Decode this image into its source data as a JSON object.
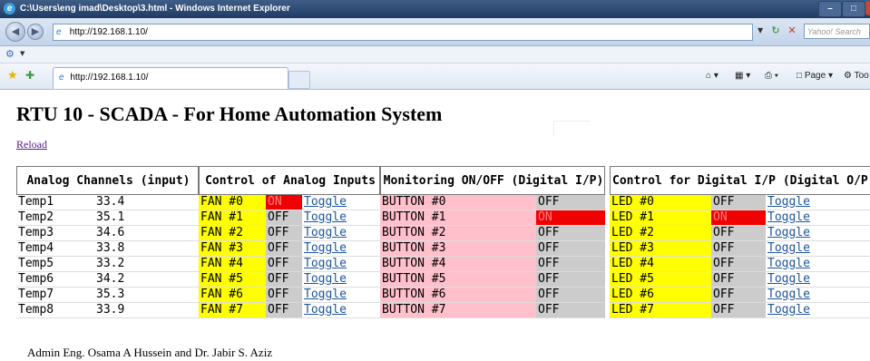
{
  "window": {
    "title": "C:\\Users\\eng imad\\Desktop\\3.html - Windows Internet Explorer",
    "address": "http://192.168.1.10/",
    "search_placeholder": "Yahoo! Search",
    "tab_title": "http://192.168.1.10/",
    "commands": {
      "page": "Page",
      "tools": "Too"
    }
  },
  "page": {
    "title": "RTU 10 - SCADA - For Home Automation System",
    "reload": "Reload",
    "footer": "Admin Eng. Osama A Hussein and Dr. Jabir S. Aziz"
  },
  "panels": {
    "analog": {
      "header": "Analog Channels (input)",
      "rows": [
        {
          "name": "Temp1",
          "value": "33.4"
        },
        {
          "name": "Temp2",
          "value": "35.1"
        },
        {
          "name": "Temp3",
          "value": "34.6"
        },
        {
          "name": "Temp4",
          "value": "33.8"
        },
        {
          "name": "Temp5",
          "value": "33.2"
        },
        {
          "name": "Temp6",
          "value": "34.2"
        },
        {
          "name": "Temp7",
          "value": "35.3"
        },
        {
          "name": "Temp8",
          "value": "33.9"
        }
      ]
    },
    "fans": {
      "header": "Control of Analog Inputs",
      "toggle": "Toggle",
      "rows": [
        {
          "label": "FAN #0",
          "state": "ON"
        },
        {
          "label": "FAN #1",
          "state": "OFF"
        },
        {
          "label": "FAN #2",
          "state": "OFF"
        },
        {
          "label": "FAN #3",
          "state": "OFF"
        },
        {
          "label": "FAN #4",
          "state": "OFF"
        },
        {
          "label": "FAN #5",
          "state": "OFF"
        },
        {
          "label": "FAN #6",
          "state": "OFF"
        },
        {
          "label": "FAN #7",
          "state": "OFF"
        }
      ]
    },
    "buttons": {
      "header": "Monitoring ON/OFF (Digital I/P)",
      "rows": [
        {
          "label": "BUTTON #0",
          "state": "OFF"
        },
        {
          "label": "BUTTON #1",
          "state": "ON"
        },
        {
          "label": "BUTTON #2",
          "state": "OFF"
        },
        {
          "label": "BUTTON #3",
          "state": "OFF"
        },
        {
          "label": "BUTTON #4",
          "state": "OFF"
        },
        {
          "label": "BUTTON #5",
          "state": "OFF"
        },
        {
          "label": "BUTTON #6",
          "state": "OFF"
        },
        {
          "label": "BUTTON #7",
          "state": "OFF"
        }
      ]
    },
    "leds": {
      "header": "Control for Digital I/P (Digital O/P)",
      "toggle": "Toggle",
      "rows": [
        {
          "label": "LED #0",
          "state": "OFF"
        },
        {
          "label": "LED #1",
          "state": "ON"
        },
        {
          "label": "LED #2",
          "state": "OFF"
        },
        {
          "label": "LED #3",
          "state": "OFF"
        },
        {
          "label": "LED #4",
          "state": "OFF"
        },
        {
          "label": "LED #5",
          "state": "OFF"
        },
        {
          "label": "LED #6",
          "state": "OFF"
        },
        {
          "label": "LED #7",
          "state": "OFF"
        }
      ]
    }
  },
  "colors": {
    "on": "#f00000",
    "off": "#cccccc",
    "label_yellow": "#ffff00",
    "label_pink": "#ffc0cb",
    "titlebar": "#2a4a75"
  }
}
